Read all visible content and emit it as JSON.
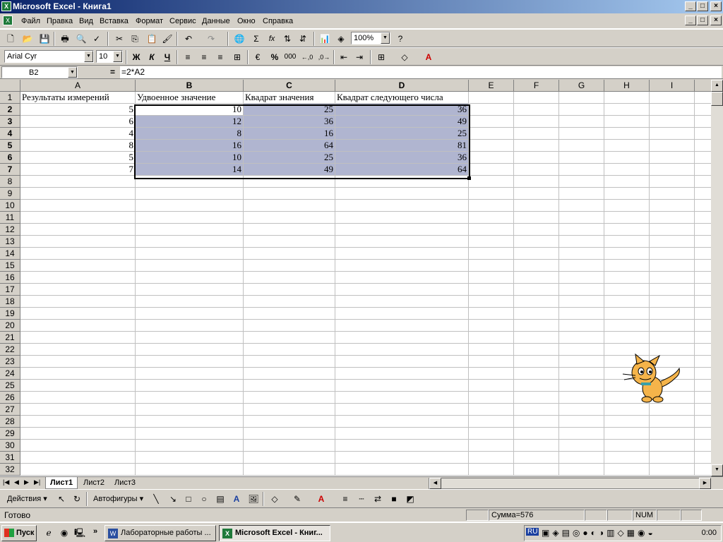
{
  "window": {
    "title": "Microsoft Excel - Книга1",
    "min": "_",
    "max": "□",
    "close": "×"
  },
  "menu": [
    "Файл",
    "Правка",
    "Вид",
    "Вставка",
    "Формат",
    "Сервис",
    "Данные",
    "Окно",
    "Справка"
  ],
  "toolbar": {
    "zoom": "100%",
    "font": "Arial Cyr",
    "size": "10",
    "bold": "Ж",
    "italic": "К",
    "underline": "Ч",
    "percent": "%",
    "thousands": "000",
    "sum": "Σ",
    "fx": "fx"
  },
  "formula_bar": {
    "name_box": "B2",
    "equals": "=",
    "formula": "=2*A2"
  },
  "columns": [
    "A",
    "B",
    "C",
    "D",
    "E",
    "F",
    "G",
    "H",
    "I"
  ],
  "rows": [
    "1",
    "2",
    "3",
    "4",
    "5",
    "6",
    "7",
    "8",
    "9",
    "10",
    "11",
    "12",
    "13",
    "14",
    "15",
    "16",
    "17",
    "18",
    "19",
    "20",
    "21",
    "22",
    "23",
    "24",
    "25",
    "26",
    "27",
    "28",
    "29",
    "30",
    "31",
    "32"
  ],
  "table": {
    "headers": [
      "Результаты измерений",
      "Удвоенное значение",
      "Квадрат значения",
      "Квадрат следующего числа"
    ],
    "data": [
      [
        "5",
        "10",
        "25",
        "36"
      ],
      [
        "6",
        "12",
        "36",
        "49"
      ],
      [
        "4",
        "8",
        "16",
        "25"
      ],
      [
        "8",
        "16",
        "64",
        "81"
      ],
      [
        "5",
        "10",
        "25",
        "36"
      ],
      [
        "7",
        "14",
        "49",
        "64"
      ]
    ]
  },
  "sheets": [
    "Лист1",
    "Лист2",
    "Лист3"
  ],
  "drawing": {
    "actions": "Действия",
    "autoshapes": "Автофигуры"
  },
  "status": {
    "ready": "Готово",
    "sum": "Сумма=576",
    "num": "NUM"
  },
  "taskbar": {
    "start": "Пуск",
    "tasks": [
      "Лабораторные работы ...",
      "Microsoft Excel - Книг..."
    ],
    "lang": "RU",
    "clock": "0:00"
  }
}
